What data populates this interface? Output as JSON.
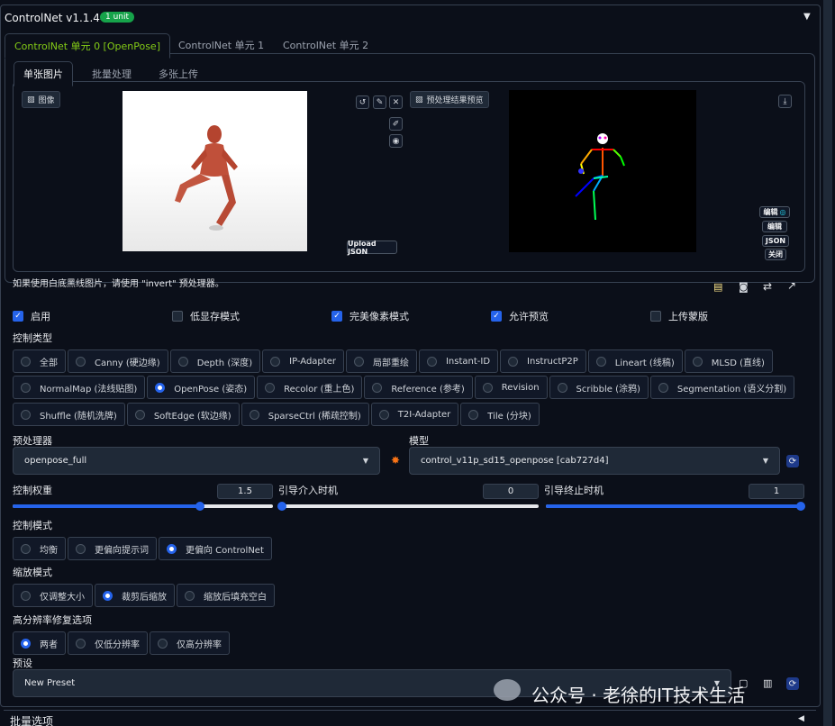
{
  "header": {
    "title": "ControlNet v1.1.445",
    "badge": "1 unit",
    "collapse_icon": "triangle-down-icon"
  },
  "unit_tabs": [
    "ControlNet 单元 0 [OpenPose]",
    "ControlNet 单元 1",
    "ControlNet 单元 2"
  ],
  "image_tabs": [
    "单张图片",
    "批量处理",
    "多张上传"
  ],
  "input_image": {
    "label": "图像",
    "upload_json": "Upload JSON"
  },
  "preview_image": {
    "label": "预处理结果预览",
    "buttons": [
      "编辑",
      "编辑",
      "JSON",
      "关闭"
    ]
  },
  "hint": "如果使用白底黑线图片，请使用 \"invert\" 预处理器。",
  "checkboxes": [
    {
      "label": "启用",
      "checked": true
    },
    {
      "label": "低显存模式",
      "checked": false
    },
    {
      "label": "完美像素模式",
      "checked": true
    },
    {
      "label": "允许预览",
      "checked": true
    },
    {
      "label": "上传蒙版",
      "checked": false
    }
  ],
  "control_type": {
    "label": "控制类型",
    "selected": "OpenPose (姿态)",
    "rows": [
      [
        "全部",
        "Canny (硬边缘)",
        "Depth (深度)",
        "IP-Adapter",
        "局部重绘",
        "Instant-ID",
        "InstructP2P",
        "Lineart (线稿)",
        "MLSD (直线)"
      ],
      [
        "NormalMap (法线贴图)",
        "OpenPose (姿态)",
        "Recolor (重上色)",
        "Reference (参考)",
        "Revision",
        "Scribble (涂鸦)",
        "Segmentation (语义分割)"
      ],
      [
        "Shuffle (随机洗牌)",
        "SoftEdge (软边缘)",
        "SparseCtrl (稀疏控制)",
        "T2I-Adapter",
        "Tile (分块)"
      ]
    ]
  },
  "preprocessor": {
    "label": "预处理器",
    "value": "openpose_full"
  },
  "model": {
    "label": "模型",
    "value": "control_v11p_sd15_openpose [cab727d4]"
  },
  "sliders": [
    {
      "label": "控制权重",
      "value": "1.5",
      "fraction": 0.72
    },
    {
      "label": "引导介入时机",
      "value": "0",
      "fraction": 0.0
    },
    {
      "label": "引导终止时机",
      "value": "1",
      "fraction": 1.0
    }
  ],
  "control_mode": {
    "label": "控制模式",
    "options": [
      "均衡",
      "更偏向提示词",
      "更偏向 ControlNet"
    ],
    "selected": "更偏向 ControlNet"
  },
  "resize_mode": {
    "label": "缩放模式",
    "options": [
      "仅调整大小",
      "裁剪后缩放",
      "缩放后填充空白"
    ],
    "selected": "裁剪后缩放"
  },
  "hires_option": {
    "label": "高分辨率修复选项",
    "options": [
      "两者",
      "仅低分辨率",
      "仅高分辨率"
    ],
    "selected": "两者"
  },
  "preset": {
    "label": "预设",
    "value": "New Preset"
  },
  "batch": {
    "label": "批量选项"
  },
  "watermark": "公众号 · 老徐的IT技术生活",
  "colors": {
    "accent": "#2563eb",
    "background": "#0b0f19",
    "tab_active": "#84cc16",
    "badge": "#16a34a"
  }
}
